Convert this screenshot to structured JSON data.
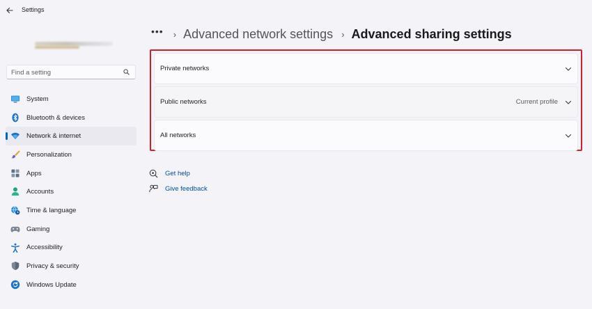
{
  "app": {
    "title": "Settings"
  },
  "search": {
    "placeholder": "Find a setting"
  },
  "sidebar": {
    "items": [
      {
        "label": "System",
        "icon": "monitor-icon"
      },
      {
        "label": "Bluetooth & devices",
        "icon": "bluetooth-icon"
      },
      {
        "label": "Network & internet",
        "icon": "wifi-icon",
        "selected": true
      },
      {
        "label": "Personalization",
        "icon": "paintbrush-icon"
      },
      {
        "label": "Apps",
        "icon": "apps-icon"
      },
      {
        "label": "Accounts",
        "icon": "person-icon"
      },
      {
        "label": "Time & language",
        "icon": "globe-clock-icon"
      },
      {
        "label": "Gaming",
        "icon": "gamepad-icon"
      },
      {
        "label": "Accessibility",
        "icon": "accessibility-icon"
      },
      {
        "label": "Privacy & security",
        "icon": "shield-icon"
      },
      {
        "label": "Windows Update",
        "icon": "refresh-icon"
      }
    ]
  },
  "breadcrumb": {
    "more": "•••",
    "parent": "Advanced network settings",
    "current": "Advanced sharing settings"
  },
  "sections": [
    {
      "label": "Private networks",
      "status": ""
    },
    {
      "label": "Public networks",
      "status": "Current profile"
    },
    {
      "label": "All networks",
      "status": ""
    }
  ],
  "links": {
    "help": "Get help",
    "feedback": "Give feedback"
  },
  "colors": {
    "accent": "#0067c0",
    "highlight_border": "#d0202a",
    "link": "#00509e"
  }
}
